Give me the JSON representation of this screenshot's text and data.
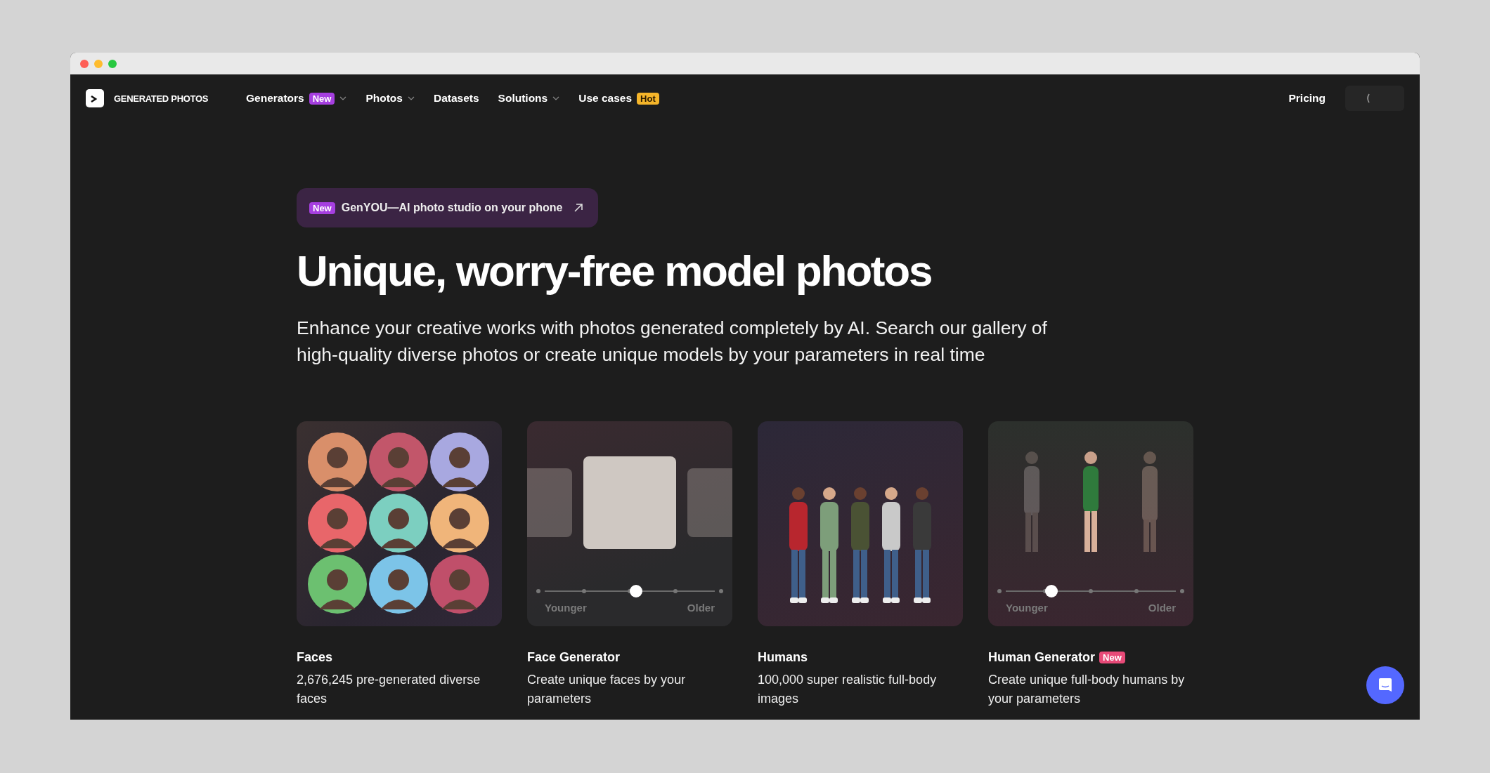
{
  "brand": {
    "name": "GENERATED PHOTOS"
  },
  "nav": [
    {
      "label": "Generators",
      "badge": {
        "text": "New",
        "color": "#a63fe0"
      },
      "dropdown": true
    },
    {
      "label": "Photos",
      "dropdown": true
    },
    {
      "label": "Datasets",
      "dropdown": false
    },
    {
      "label": "Solutions",
      "dropdown": true
    },
    {
      "label": "Use cases",
      "badge": {
        "text": "Hot",
        "color": "#f5b52a"
      },
      "dropdown": false
    }
  ],
  "nav_right": {
    "pricing": "Pricing"
  },
  "announcement": {
    "badge": "New",
    "text": "GenYOU—AI photo studio on your phone"
  },
  "hero": {
    "title": "Unique, worry-free model photos",
    "subtitle": "Enhance your creative works with photos generated completely by AI. Search our gallery of high-quality diverse photos or create unique models by your parameters in real time"
  },
  "cards": [
    {
      "kind": "faces",
      "title": "Faces",
      "description": "2,676,245 pre-generated diverse faces"
    },
    {
      "kind": "face-generator",
      "title": "Face Generator",
      "description": "Create unique faces by your parameters",
      "slider": {
        "min_label": "Younger",
        "max_label": "Older",
        "level": 0.5
      }
    },
    {
      "kind": "humans",
      "title": "Humans",
      "description": "100,000 super realistic full-body images"
    },
    {
      "kind": "human-generator",
      "title": "Human Generator",
      "badge": "New",
      "description": "Create unique full-body humans by your parameters",
      "slider": {
        "min_label": "Younger",
        "max_label": "Older",
        "level": 0.25
      }
    }
  ]
}
